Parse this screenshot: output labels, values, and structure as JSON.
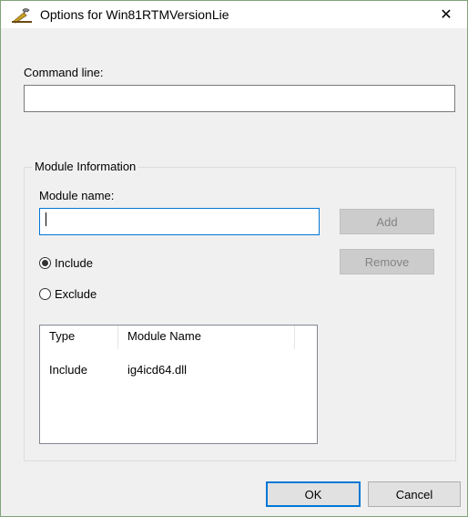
{
  "window": {
    "title": "Options for Win81RTMVersionLie",
    "title_icon": "shim-wrench-icon",
    "close_glyph": "✕"
  },
  "command_line": {
    "label": "Command line:",
    "value": ""
  },
  "module_info": {
    "group_label": "Module Information",
    "module_name_label": "Module name:",
    "module_name_value": "",
    "add_label": "Add",
    "remove_label": "Remove",
    "include_label": "Include",
    "exclude_label": "Exclude",
    "selected_mode": "Include",
    "list": {
      "columns": [
        "Type",
        "Module Name"
      ],
      "rows": [
        {
          "type": "Include",
          "module_name": "ig4icd64.dll"
        }
      ]
    }
  },
  "footer": {
    "ok_label": "OK",
    "cancel_label": "Cancel"
  },
  "colors": {
    "focus_border": "#0078d7",
    "dialog_bg": "#f0f0f0",
    "disabled_button": "#cccccc"
  }
}
